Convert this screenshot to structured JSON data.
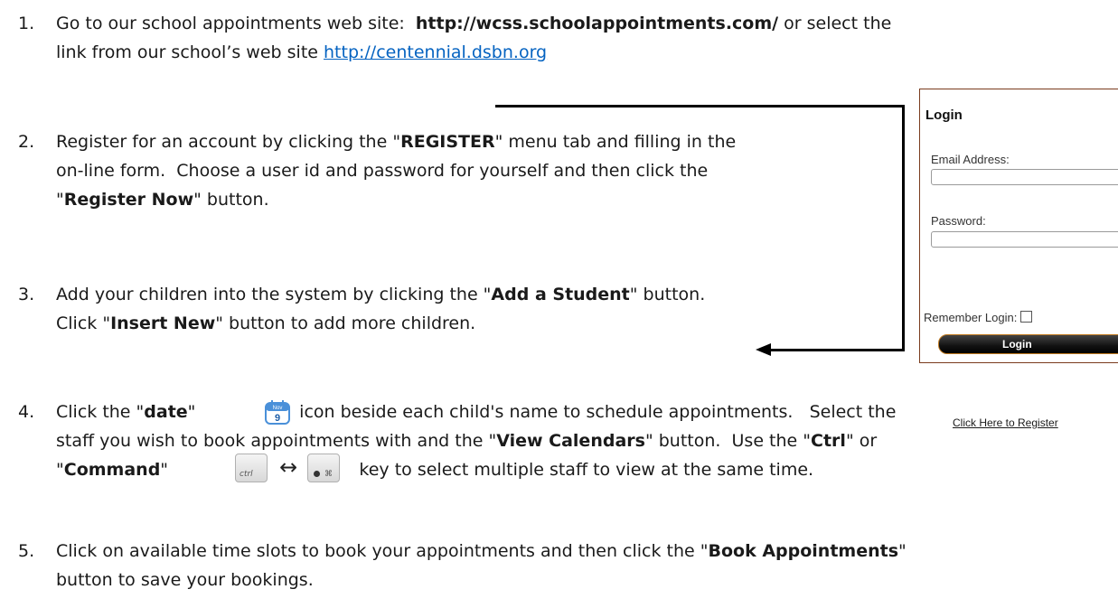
{
  "steps": [
    {
      "number": "1.",
      "lines": [
        [
          {
            "t": "Go to our school appointments web site:  "
          },
          {
            "t": "http://wcss.schoolappointments.com/",
            "b": true
          },
          {
            "t": " or select the"
          }
        ],
        [
          {
            "t": "link from our school’s web site "
          },
          {
            "t": "http://centennial.dsbn.org",
            "link": true
          }
        ]
      ]
    },
    {
      "number": "2.",
      "lines": [
        [
          {
            "t": "Register for an account by clicking the \""
          },
          {
            "t": "REGISTER",
            "b": true
          },
          {
            "t": "\" menu tab and filling in the"
          }
        ],
        [
          {
            "t": "on-line form.  Choose a user id and password for yourself and then click the"
          }
        ],
        [
          {
            "t": "\""
          },
          {
            "t": "Register Now",
            "b": true
          },
          {
            "t": "\" button."
          }
        ]
      ]
    },
    {
      "number": "3.",
      "lines": [
        [
          {
            "t": "Add your children into the system by clicking the \""
          },
          {
            "t": "Add a Student",
            "b": true
          },
          {
            "t": "\" button."
          }
        ],
        [
          {
            "t": "Click \""
          },
          {
            "t": "Insert New",
            "b": true
          },
          {
            "t": "\" button to add more children."
          }
        ]
      ]
    },
    {
      "number": "4.",
      "lines": [
        [
          {
            "t": "Click the \""
          },
          {
            "t": "date",
            "b": true
          },
          {
            "t": "\"                   icon beside each child's name to schedule appointments.   Select the"
          }
        ],
        [
          {
            "t": "staff you wish to book appointments with and the \""
          },
          {
            "t": "View Calendars",
            "b": true
          },
          {
            "t": "\" button.  Use the \""
          },
          {
            "t": "Ctrl",
            "b": true
          },
          {
            "t": "\" or"
          }
        ],
        [
          {
            "t": "\""
          },
          {
            "t": "Command",
            "b": true
          },
          {
            "t": "\"                                   key to select multiple staff to view at the same time."
          }
        ]
      ]
    },
    {
      "number": "5.",
      "lines": [
        [
          {
            "t": "Click on available time slots to book your appointments and then click the \""
          },
          {
            "t": "Book Appointments",
            "b": true
          },
          {
            "t": "\""
          }
        ],
        [
          {
            "t": "button to save your bookings."
          }
        ]
      ]
    }
  ],
  "login_panel": {
    "title": "Login",
    "email_label": "Email Address:",
    "password_label": "Password:",
    "remember_label": "Remember Login:",
    "login_button": "Login",
    "register_link": "Click Here to Register"
  },
  "icons": {
    "calendar_month": "Nov",
    "calendar_day": "9",
    "ctrl_key": "ctrl",
    "command_key": "⌘",
    "arrow": "↔"
  },
  "colors": {
    "link": "#0563c1",
    "panel_border": "#7a3b1d",
    "calendar_blue": "#4a90d9"
  }
}
